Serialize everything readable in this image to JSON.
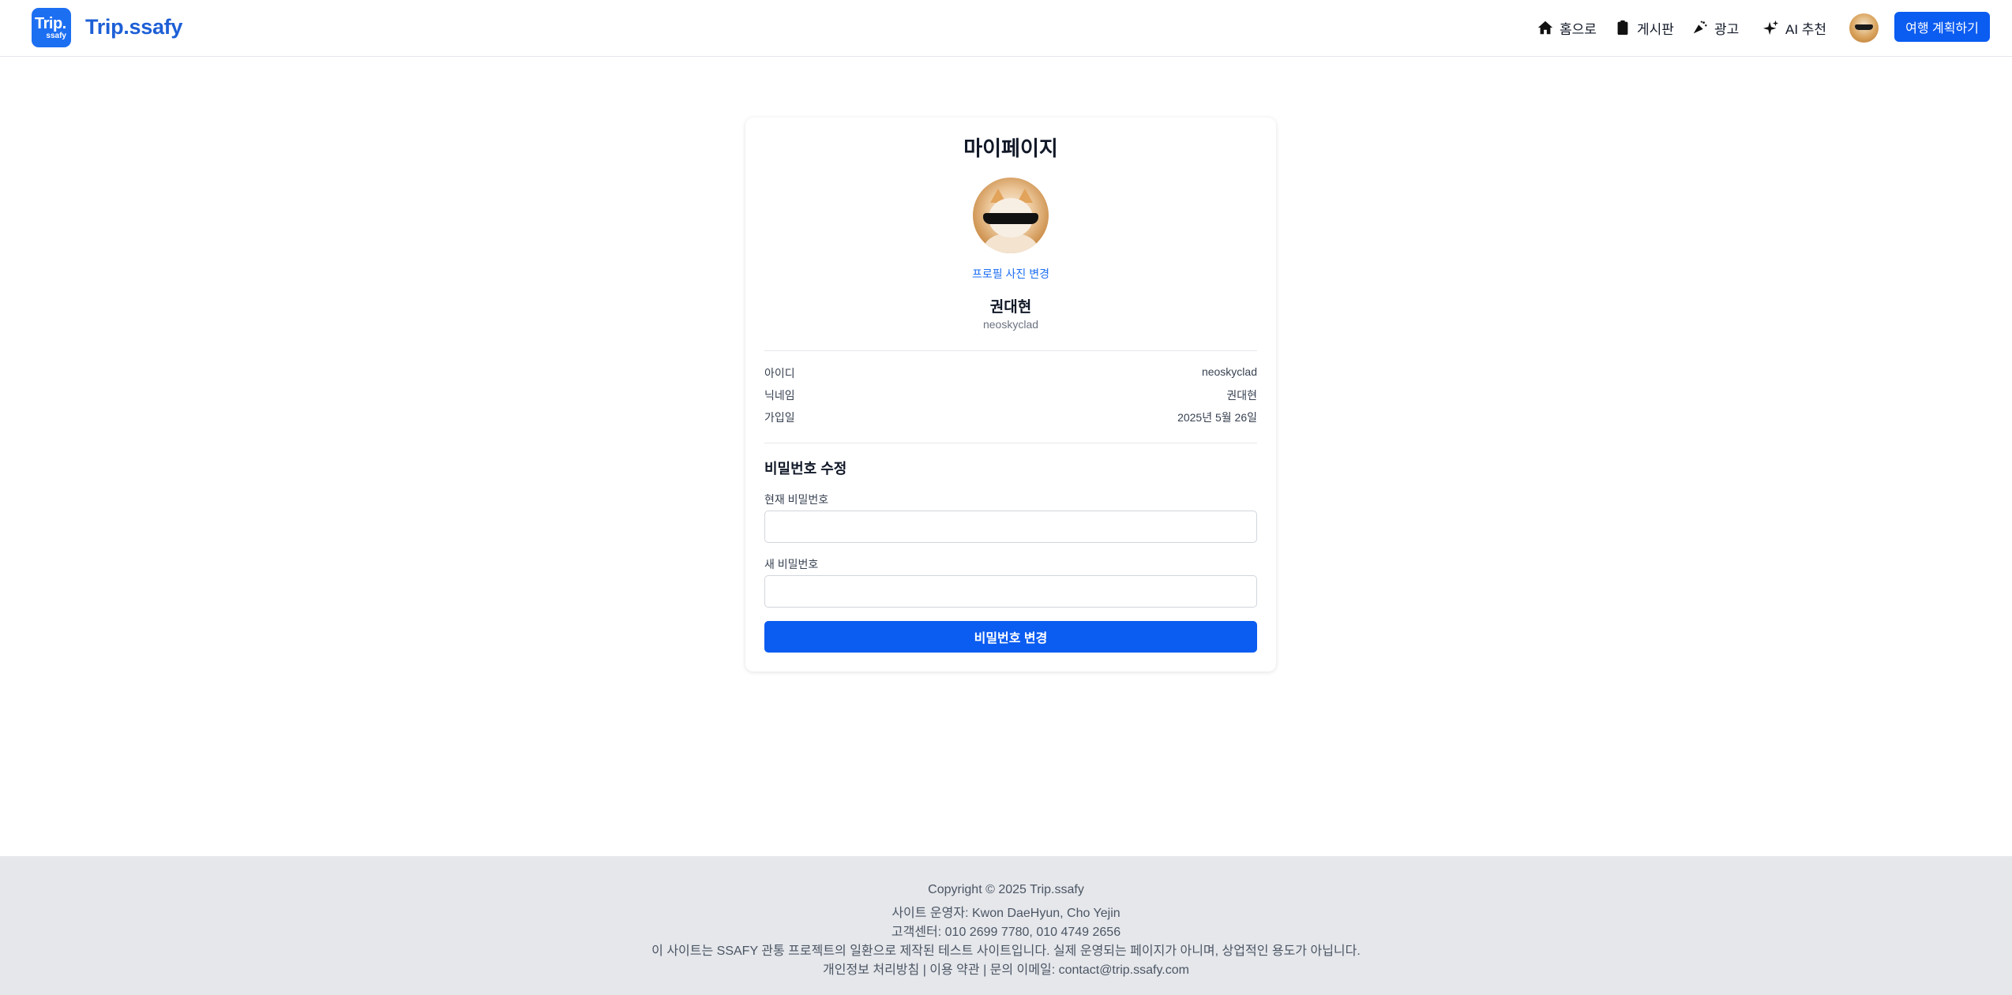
{
  "header": {
    "logo_line1": "Trip.",
    "logo_line2": "ssafy",
    "brand": "Trip.ssafy",
    "nav": [
      {
        "label": "홈으로",
        "icon": "home-icon"
      },
      {
        "label": "게시판",
        "icon": "clipboard-icon"
      },
      {
        "label": "광고",
        "icon": "megaphone-icon"
      },
      {
        "label": "AI 추천",
        "icon": "sparkles-icon"
      }
    ],
    "plan_button": "여행 계획하기"
  },
  "profile": {
    "title": "마이페이지",
    "change_photo": "프로필 사진 변경",
    "name": "권대현",
    "username": "neoskyclad",
    "info": [
      {
        "label": "아이디",
        "value": "neoskyclad"
      },
      {
        "label": "닉네임",
        "value": "권대현"
      },
      {
        "label": "가입일",
        "value": "2025년 5월 26일"
      }
    ]
  },
  "password": {
    "section_title": "비밀번호 수정",
    "current_label": "현재 비밀번호",
    "current_value": "",
    "new_label": "새 비밀번호",
    "new_value": "",
    "submit": "비밀번호 변경"
  },
  "footer": {
    "lines": [
      "Copyright © 2025 Trip.ssafy",
      "사이트 운영자: Kwon DaeHyun, Cho Yejin",
      "고객센터: 010 2699 7780, 010 4749 2656",
      "이 사이트는 SSAFY 관통 프로젝트의 일환으로 제작된 테스트 사이트입니다. 실제 운영되는 페이지가 아니며, 상업적인 용도가 아닙니다.",
      "개인정보 처리방침 | 이용 약관 | 문의 이메일: contact@trip.ssafy.com"
    ]
  },
  "colors": {
    "accent": "#0b5cf0",
    "brand": "#1d5fd6",
    "footer_bg": "#e5e7eb"
  }
}
